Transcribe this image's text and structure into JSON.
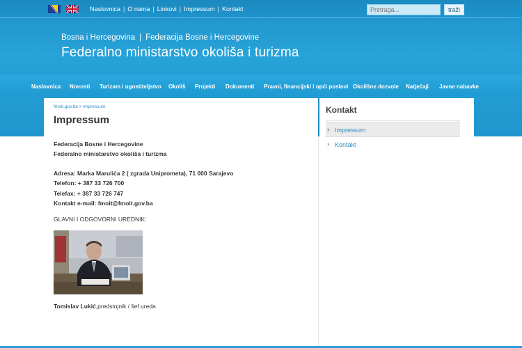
{
  "topbar": {
    "nav": [
      "Naslovnica",
      "O nama",
      "Linkovi",
      "Impressum",
      "Kontakt"
    ],
    "search_placeholder": "Pretraga...",
    "search_button": "traži"
  },
  "header": {
    "subtitle_left": "Bosna i Hercegovina",
    "subtitle_sep": "|",
    "subtitle_right": "Federacija Bosne i Hercegovine",
    "title": "Federalno ministarstvo okoliša i turizma"
  },
  "mainnav": [
    "Naslovnica",
    "Novosti",
    "Turizam i ugostiteljstvo",
    "Okoliš",
    "Projekti",
    "Dokumenti",
    "Pravni, financijski i opći poslovi",
    "Okolišne dozvole",
    "Natječaji",
    "Javne nabavke"
  ],
  "content": {
    "breadcrumb": "fmoit.gov.ba > Impressum",
    "title": "Impressum",
    "lines": [
      "Federacija Bosne i Hercegovine",
      "Federalno ministarstvo okoliša i turizma",
      "Adresa: Marka Marulića 2 ( zgrada Uniprometa), 71 000 Sarajevo",
      "Telefon: + 387 33 726 700",
      "Telefax: + 387 33 726 747",
      "Kontakt e-mail: fmoit@fmoit.gov.ba",
      "GLAVNI I ODGOVORNI UREDNIK:"
    ],
    "caption_name": "Tomislav Lukić",
    "caption_role": ",predstojnik / šef ureda"
  },
  "sidebar": {
    "title": "Kontakt",
    "items": [
      "Impressum",
      "Kontakt"
    ]
  }
}
